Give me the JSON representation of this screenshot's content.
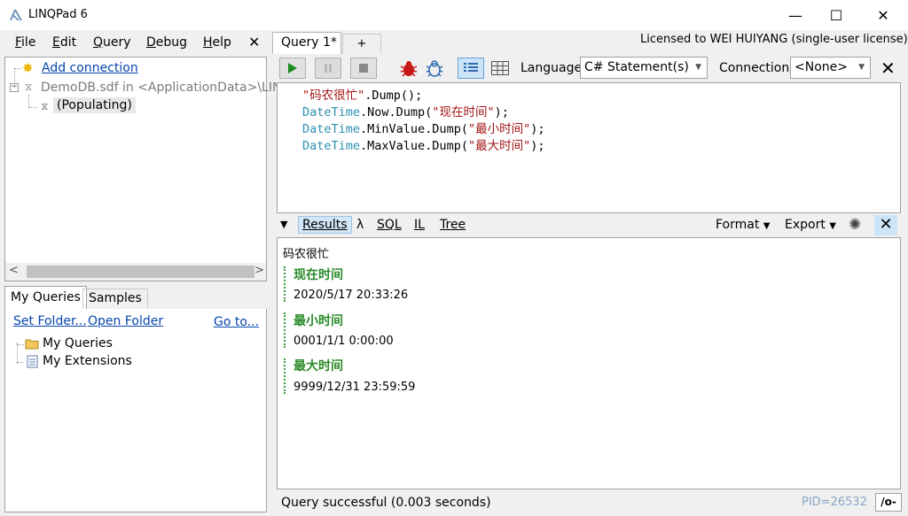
{
  "window": {
    "title": "LINQPad 6",
    "minimize": "—",
    "maximize": "☐",
    "close": "✕"
  },
  "menu": {
    "items": [
      {
        "first": "F",
        "rest": "ile"
      },
      {
        "first": "E",
        "rest": "dit"
      },
      {
        "first": "Q",
        "rest": "uery"
      },
      {
        "first": "D",
        "rest": "ebug"
      },
      {
        "first": "H",
        "rest": "elp"
      }
    ],
    "close": "✕"
  },
  "tree": {
    "add_connection": "Add connection",
    "db": "DemoDB.sdf in <ApplicationData>\\LIN",
    "populating": "(Populating)"
  },
  "scroll": {
    "left": "<",
    "right": ">"
  },
  "left_tabs": {
    "my_queries": "My Queries",
    "samples": "Samples"
  },
  "left_links": {
    "set_folder": "Set Folder...",
    "open_folder": "Open Folder",
    "goto": "Go to..."
  },
  "left_tree": {
    "my_queries": "My Queries",
    "my_extensions": "My Extensions"
  },
  "query_tabs": {
    "current": "Query 1*",
    "add": "+"
  },
  "license": "Licensed to WEI HUIYANG (single-user license)",
  "toolbar": {
    "language_label": "Language",
    "language_value": "C# Statement(s)",
    "connection_label": "Connection",
    "connection_value": "<None>",
    "close": "✕"
  },
  "code": [
    [
      {
        "t": "\"码农很忙\"",
        "c": "c-str"
      },
      {
        "t": ".Dump();",
        "c": "c-plain"
      }
    ],
    [
      {
        "t": "DateTime",
        "c": "c-type"
      },
      {
        "t": ".Now.Dump(",
        "c": "c-plain"
      },
      {
        "t": "\"现在时间\"",
        "c": "c-str"
      },
      {
        "t": ");",
        "c": "c-plain"
      }
    ],
    [
      {
        "t": "DateTime",
        "c": "c-type"
      },
      {
        "t": ".MinValue.Dump(",
        "c": "c-plain"
      },
      {
        "t": "\"最小时间\"",
        "c": "c-str"
      },
      {
        "t": ");",
        "c": "c-plain"
      }
    ],
    [
      {
        "t": "DateTime",
        "c": "c-type"
      },
      {
        "t": ".MaxValue.Dump(",
        "c": "c-plain"
      },
      {
        "t": "\"最大时间\"",
        "c": "c-str"
      },
      {
        "t": ");",
        "c": "c-plain"
      }
    ]
  ],
  "results_tabs": {
    "results": "Results",
    "lambda": "λ",
    "sql": "SQL",
    "il": "IL",
    "tree": "Tree",
    "format": "Format",
    "export": "Export"
  },
  "results": {
    "first": "码农很忙",
    "groups": [
      {
        "head": "现在时间",
        "value": "2020/5/17 20:33:26"
      },
      {
        "head": "最小时间",
        "value": "0001/1/1 0:00:00"
      },
      {
        "head": "最大时间",
        "value": "9999/12/31 23:59:59"
      }
    ]
  },
  "status": {
    "text": "Query successful  (0.003 seconds)",
    "pid": "PID=26532",
    "btn": "/o-"
  },
  "colors": {
    "accent": "#0645ad",
    "result_head": "#2a8a2a",
    "string": "#a31515",
    "type": "#2b91af"
  }
}
